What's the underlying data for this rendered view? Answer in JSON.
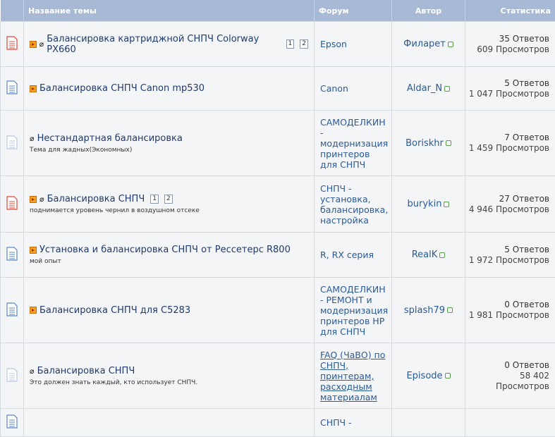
{
  "header": {
    "col_name": "Название темы",
    "col_forum": "Форум",
    "col_author": "Автор",
    "col_stats": "Статистика"
  },
  "rows": [
    {
      "icon": "hot-topic-icon",
      "icon_color": "#e0463a",
      "has_new": true,
      "has_attach": true,
      "title": "Балансировка картриджной СНПЧ Colorway PX660",
      "pages": [
        "1",
        "2"
      ],
      "subtitle": "",
      "forum": "Epson",
      "author": "Филарет",
      "replies": "35 Ответов",
      "views": "609 Просмотров"
    },
    {
      "icon": "topic-icon",
      "icon_color": "#5a86c8",
      "has_new": true,
      "has_attach": false,
      "title": "Балансировка СНПЧ Canon mp530",
      "pages": [],
      "subtitle": "",
      "forum": "Canon",
      "author": "Aldar_N",
      "replies": "5 Ответов",
      "views": "1 047 Просмотров"
    },
    {
      "icon": "faded-topic-icon",
      "icon_color": "#b9c8e0",
      "has_new": false,
      "has_attach": true,
      "title": "Нестандартная балансировка",
      "pages": [],
      "subtitle": "Тема для жадных(Экономных)",
      "forum": "САМОДЕЛКИН - модернизация принтеров для СНПЧ",
      "author": "Boriskhr",
      "replies": "7 Ответов",
      "views": "1 459 Просмотров"
    },
    {
      "icon": "hot-topic-icon",
      "icon_color": "#e0463a",
      "has_new": true,
      "has_attach": true,
      "title": "Балансировка СНПЧ",
      "pages": [
        "1",
        "2"
      ],
      "subtitle": "поднимается уровень чернил в воздушном отсеке",
      "forum": "СНПЧ - установка, балансировка, настройка",
      "author": "burykin",
      "replies": "27 Ответов",
      "views": "4 946 Просмотров"
    },
    {
      "icon": "topic-icon",
      "icon_color": "#5a86c8",
      "has_new": true,
      "has_attach": false,
      "title": "Установка и балансировка СНПЧ от Рессетерс R800",
      "pages": [],
      "subtitle": "мой опыт",
      "forum": "R, RX серия",
      "author": "RealK",
      "replies": "5 Ответов",
      "views": "1 972 Просмотров"
    },
    {
      "icon": "topic-icon",
      "icon_color": "#5a86c8",
      "has_new": true,
      "has_attach": false,
      "title": "Балансировка СНПЧ для C5283",
      "pages": [],
      "subtitle": "",
      "forum": "САМОДЕЛКИН - РЕМОНТ и модернизация принтеров HP для СНПЧ",
      "author": "splash79",
      "replies": "0 Ответов",
      "views": "1 981 Просмотров"
    },
    {
      "icon": "faded-topic-icon",
      "icon_color": "#b9c8e0",
      "has_new": false,
      "has_attach": true,
      "title": "Балансировка СНПЧ",
      "pages": [],
      "subtitle": "Это должен знать каждый, кто использует СНПЧ.",
      "forum": "FAQ (ЧаВО) по СНПЧ, принтерам, расходным материалам",
      "author": "Episode",
      "replies": "0 Ответов",
      "views": "58 402 Просмотров"
    },
    {
      "icon": "topic-icon",
      "icon_color": "#5a86c8",
      "has_new": false,
      "has_attach": false,
      "title": "",
      "pages": [],
      "subtitle": "",
      "forum": "СНПЧ -",
      "author": "",
      "replies": "",
      "views": ""
    }
  ]
}
